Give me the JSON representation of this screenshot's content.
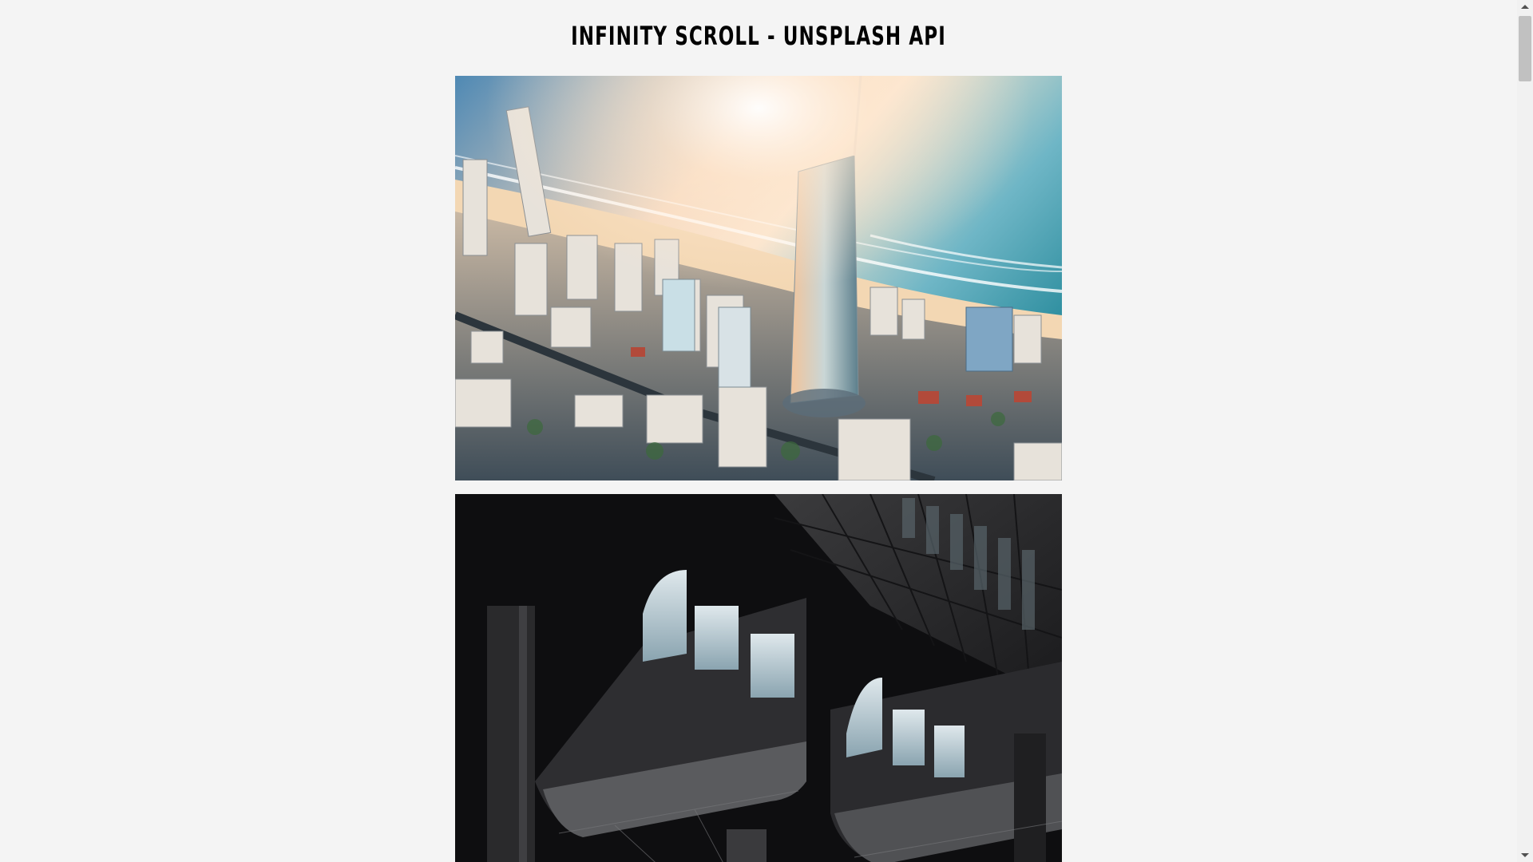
{
  "page": {
    "title": "INFINITY SCROLL - UNSPLASH API"
  },
  "images": [
    {
      "name": "photo-aerial-coastal-city"
    },
    {
      "name": "photo-dark-building-facade"
    }
  ],
  "colors": {
    "background": "#f4f4f4",
    "title": "#000000"
  }
}
